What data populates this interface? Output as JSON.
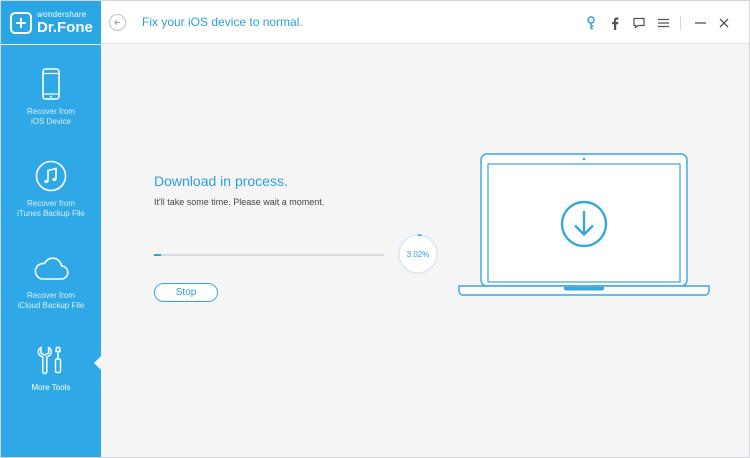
{
  "app": {
    "brand": "wondershare",
    "product": "Dr.Fone",
    "title": "Fix your iOS device to normal."
  },
  "toolbar": {
    "icons": [
      "key-icon",
      "facebook-icon",
      "feedback-icon",
      "menu-icon",
      "minimize-icon",
      "close-icon"
    ]
  },
  "sidebar": {
    "items": [
      {
        "label": "Recover from\niOS Device",
        "icon": "phone-icon"
      },
      {
        "label": "Recover from\niTunes Backup File",
        "icon": "music-note-icon"
      },
      {
        "label": "Recover from\niCloud Backup File",
        "icon": "cloud-icon"
      },
      {
        "label": "More Tools",
        "icon": "tools-icon",
        "active": true
      }
    ]
  },
  "main": {
    "status_title": "Download in process.",
    "status_subtitle": "It'll take some time. Please wait a moment.",
    "progress_percent": 3.02,
    "progress_label": "3.02%",
    "stop_label": "Stop"
  },
  "colors": {
    "accent": "#2d9fd9",
    "sidebar": "#2ea8e6",
    "background": "#f5f5f5"
  }
}
